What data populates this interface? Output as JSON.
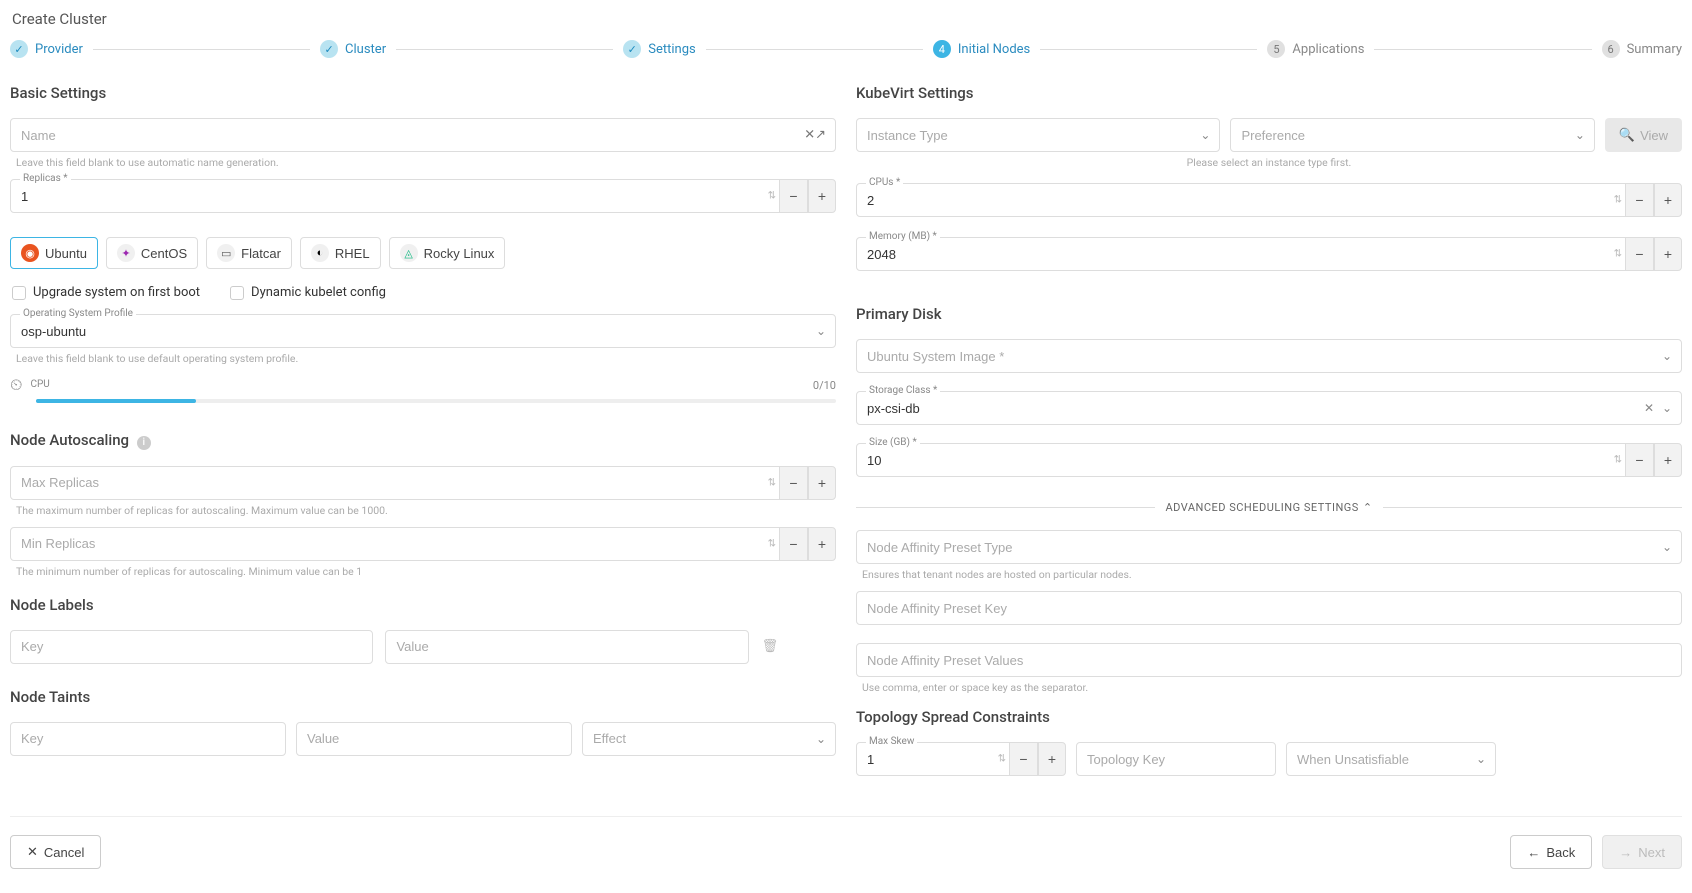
{
  "page_title": "Create Cluster",
  "steps": [
    {
      "label": "Provider",
      "state": "done",
      "mark": "✓"
    },
    {
      "label": "Cluster",
      "state": "done",
      "mark": "✓"
    },
    {
      "label": "Settings",
      "state": "done",
      "mark": "✓"
    },
    {
      "label": "Initial Nodes",
      "state": "active",
      "mark": "4"
    },
    {
      "label": "Applications",
      "state": "pending",
      "mark": "5"
    },
    {
      "label": "Summary",
      "state": "pending",
      "mark": "6"
    }
  ],
  "basic": {
    "heading": "Basic Settings",
    "name_placeholder": "Name",
    "name_hint": "Leave this field blank to use automatic name generation.",
    "shuffle_icon": "⤨",
    "replicas_label": "Replicas *",
    "replicas_value": "1",
    "os_options": [
      "Ubuntu",
      "CentOS",
      "Flatcar",
      "RHEL",
      "Rocky Linux"
    ],
    "os_selected": "Ubuntu",
    "upgrade_label": "Upgrade system on first boot",
    "dynamic_kubelet_label": "Dynamic kubelet config",
    "osp_label": "Operating System Profile",
    "osp_value": "osp-ubuntu",
    "osp_hint": "Leave this field blank to use default operating system profile.",
    "cpu_label": "CPU",
    "cpu_usage": "0/10"
  },
  "autoscaling": {
    "heading": "Node Autoscaling",
    "max_placeholder": "Max Replicas",
    "max_hint": "The maximum number of replicas for autoscaling. Maximum value can be 1000.",
    "min_placeholder": "Min Replicas",
    "min_hint": "The minimum number of replicas for autoscaling. Minimum value can be 1"
  },
  "labels": {
    "heading": "Node Labels",
    "key_placeholder": "Key",
    "value_placeholder": "Value"
  },
  "taints": {
    "heading": "Node Taints",
    "key_placeholder": "Key",
    "value_placeholder": "Value",
    "effect_placeholder": "Effect"
  },
  "kubevirt": {
    "heading": "KubeVirt Settings",
    "instance_type_placeholder": "Instance Type",
    "preference_placeholder": "Preference",
    "preference_hint": "Please select an instance type first.",
    "view_label": "View",
    "cpus_label": "CPUs *",
    "cpus_value": "2",
    "memory_label": "Memory (MB) *",
    "memory_value": "2048"
  },
  "primary_disk": {
    "heading": "Primary Disk",
    "image_placeholder": "Ubuntu System Image *",
    "storage_class_label": "Storage Class *",
    "storage_class_value": "px-csi-db",
    "size_label": "Size (GB) *",
    "size_value": "10"
  },
  "advanced": {
    "toggle_label": "ADVANCED SCHEDULING SETTINGS",
    "affinity_type_placeholder": "Node Affinity Preset Type",
    "affinity_type_hint": "Ensures that tenant nodes are hosted on particular nodes.",
    "affinity_key_placeholder": "Node Affinity Preset Key",
    "affinity_values_placeholder": "Node Affinity Preset Values",
    "affinity_values_hint": "Use comma, enter or space key as the separator."
  },
  "topology": {
    "heading": "Topology Spread Constraints",
    "max_skew_label": "Max Skew",
    "max_skew_value": "1",
    "topology_key_placeholder": "Topology Key",
    "when_unsatisfiable_placeholder": "When Unsatisfiable"
  },
  "footer": {
    "cancel": "Cancel",
    "back": "Back",
    "next": "Next"
  }
}
